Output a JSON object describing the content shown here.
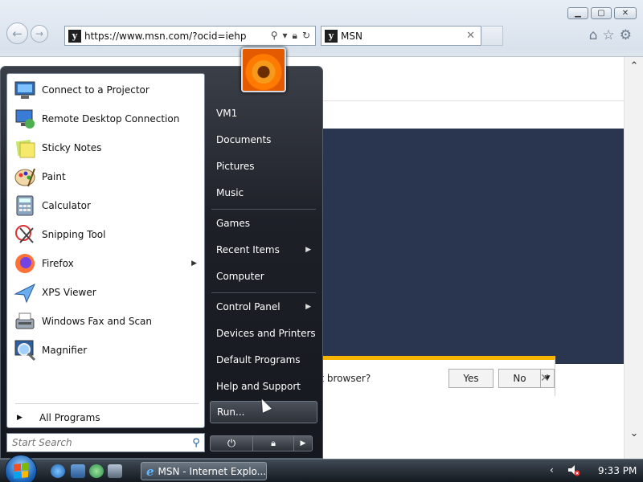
{
  "browser": {
    "address": "https://www.msn.com/?ocid=iehp",
    "tab_title": "MSN",
    "notification": {
      "text": "lt browser?",
      "yes_label": "Yes",
      "no_label": "No"
    }
  },
  "start_menu": {
    "programs": [
      {
        "label": "Connect to a Projector",
        "icon": "projector-icon"
      },
      {
        "label": "Remote Desktop Connection",
        "icon": "remote-desktop-icon"
      },
      {
        "label": "Sticky Notes",
        "icon": "sticky-notes-icon"
      },
      {
        "label": "Paint",
        "icon": "paint-icon"
      },
      {
        "label": "Calculator",
        "icon": "calculator-icon"
      },
      {
        "label": "Snipping Tool",
        "icon": "snipping-tool-icon"
      },
      {
        "label": "Firefox",
        "icon": "firefox-icon"
      },
      {
        "label": "XPS Viewer",
        "icon": "xps-viewer-icon"
      },
      {
        "label": "Windows Fax and Scan",
        "icon": "fax-scan-icon"
      },
      {
        "label": "Magnifier",
        "icon": "magnifier-icon"
      }
    ],
    "all_programs": "All Programs",
    "search_placeholder": "Start Search",
    "right_items": [
      {
        "label": "VM1"
      },
      {
        "label": "Documents"
      },
      {
        "label": "Pictures"
      },
      {
        "label": "Music"
      },
      {
        "label": "Games"
      },
      {
        "label": "Recent Items"
      },
      {
        "label": "Computer"
      },
      {
        "label": "Control Panel"
      },
      {
        "label": "Devices and Printers"
      },
      {
        "label": "Default Programs"
      },
      {
        "label": "Help and Support"
      },
      {
        "label": "Run..."
      }
    ]
  },
  "taskbar": {
    "task_label": "MSN - Internet Explo...",
    "clock": "9:33 PM"
  },
  "colors": {
    "start_menu_bg": "#1d2027",
    "taskbar_bg": "#14191f",
    "msn_hero": "#2a3550",
    "notify_accent": "#f7b500"
  }
}
